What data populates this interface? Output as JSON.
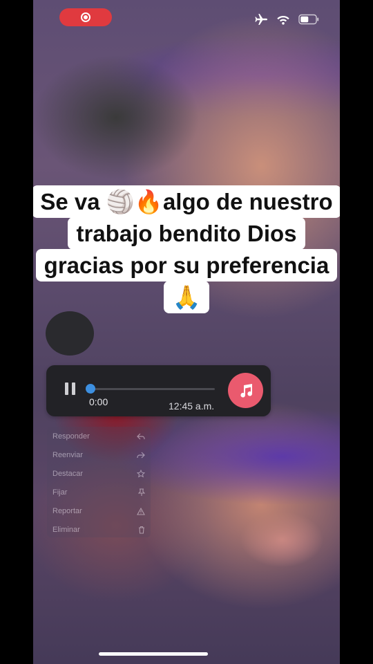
{
  "status_bar": {
    "icons": [
      "record-icon",
      "airplane-icon",
      "wifi-icon",
      "battery-icon"
    ],
    "colors": {
      "record_pill": "#e03a3f"
    }
  },
  "caption": {
    "lines": [
      "Se va 🏐🔥algo de nuestro",
      "trabajo bendito Dios",
      "gracias por su preferencia",
      "🙏"
    ]
  },
  "audio_player": {
    "current_time": "0:00",
    "sent_time": "12:45 a.m.",
    "progress": 0,
    "colors": {
      "accent": "#3d8fe0",
      "music_button": "#ea5a6e",
      "background": "#222226"
    }
  },
  "context_menu": {
    "items": [
      {
        "label": "Responder",
        "icon": "reply-icon"
      },
      {
        "label": "Reenviar",
        "icon": "forward-icon"
      },
      {
        "label": "Destacar",
        "icon": "star-icon"
      },
      {
        "label": "Fijar",
        "icon": "pin-icon"
      },
      {
        "label": "Reportar",
        "icon": "warning-icon"
      },
      {
        "label": "Eliminar",
        "icon": "trash-icon"
      }
    ]
  }
}
